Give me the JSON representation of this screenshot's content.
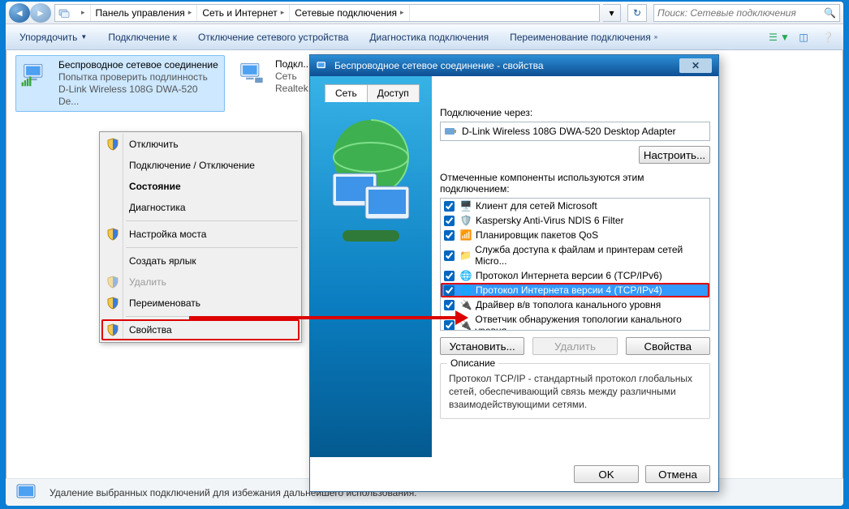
{
  "breadcrumb": {
    "parts": [
      "Панель управления",
      "Сеть и Интернет",
      "Сетевые подключения"
    ]
  },
  "search": {
    "placeholder": "Поиск: Сетевые подключения"
  },
  "toolbar": {
    "organize": "Упорядочить",
    "connect": "Подключение к",
    "disable": "Отключение сетевого устройства",
    "diag": "Диагностика подключения",
    "rename": "Переименование подключения"
  },
  "connections": {
    "wifi": {
      "name": "Беспроводное сетевое соединение",
      "status": "Попытка проверить подлинность",
      "device": "D-Link Wireless 108G DWA-520 De..."
    },
    "lan": {
      "name": "Подкл...",
      "status": "Сеть",
      "device": "Realtek..."
    }
  },
  "ctx": {
    "disable": "Отключить",
    "conn_disc": "Подключение / Отключение",
    "state": "Состояние",
    "diag": "Диагностика",
    "bridge": "Настройка моста",
    "shortcut": "Создать ярлык",
    "delete": "Удалить",
    "rename": "Переименовать",
    "props": "Свойства"
  },
  "dlg": {
    "title": "Беспроводное сетевое соединение - свойства",
    "tab_net": "Сеть",
    "tab_access": "Доступ",
    "connect_via": "Подключение через:",
    "adapter": "D-Link Wireless 108G DWA-520 Desktop Adapter",
    "configure": "Настроить...",
    "components_label": "Отмеченные компоненты используются этим подключением:",
    "components": [
      "Клиент для сетей Microsoft",
      "Kaspersky Anti-Virus NDIS 6 Filter",
      "Планировщик пакетов QoS",
      "Служба доступа к файлам и принтерам сетей Micro...",
      "Протокол Интернета версии 6 (TCP/IPv6)",
      "Протокол Интернета версии 4 (TCP/IPv4)",
      "Драйвер в/в тополога канального уровня",
      "Ответчик обнаружения топологии канального уровня"
    ],
    "install": "Установить...",
    "remove": "Удалить",
    "props": "Свойства",
    "desc_title": "Описание",
    "desc": "Протокол TCP/IP - стандартный протокол глобальных сетей, обеспечивающий связь между различными взаимодействующими сетями.",
    "ok": "OK",
    "cancel": "Отмена"
  },
  "status": "Удаление выбранных подключений для избежания дальнейшего использования."
}
